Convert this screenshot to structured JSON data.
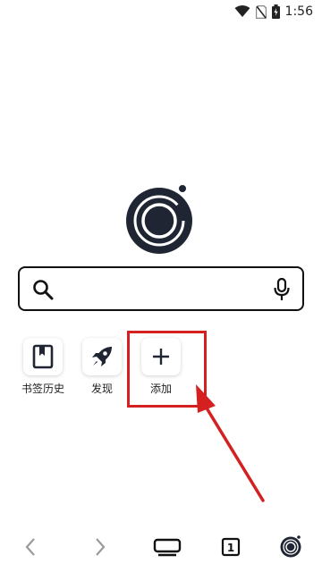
{
  "status_bar": {
    "time": "1:56",
    "icons": [
      "wifi-icon",
      "no-sim-icon",
      "battery-charging-icon"
    ]
  },
  "brand": {
    "logo": "browser-logo"
  },
  "search": {
    "value": "",
    "placeholder": "",
    "icons": [
      "search-icon",
      "microphone-icon"
    ]
  },
  "shortcuts": [
    {
      "label": "书签历史",
      "icon": "bookmark-icon"
    },
    {
      "label": "发现",
      "icon": "rocket-icon"
    },
    {
      "label": "添加",
      "icon": "plus-icon"
    }
  ],
  "annotation": {
    "color": "#d42020"
  },
  "bottom_nav": {
    "icons": [
      "back-icon",
      "forward-icon",
      "display-mode-icon",
      "tabs-icon",
      "menu-logo-icon"
    ],
    "tab_count": "1"
  }
}
